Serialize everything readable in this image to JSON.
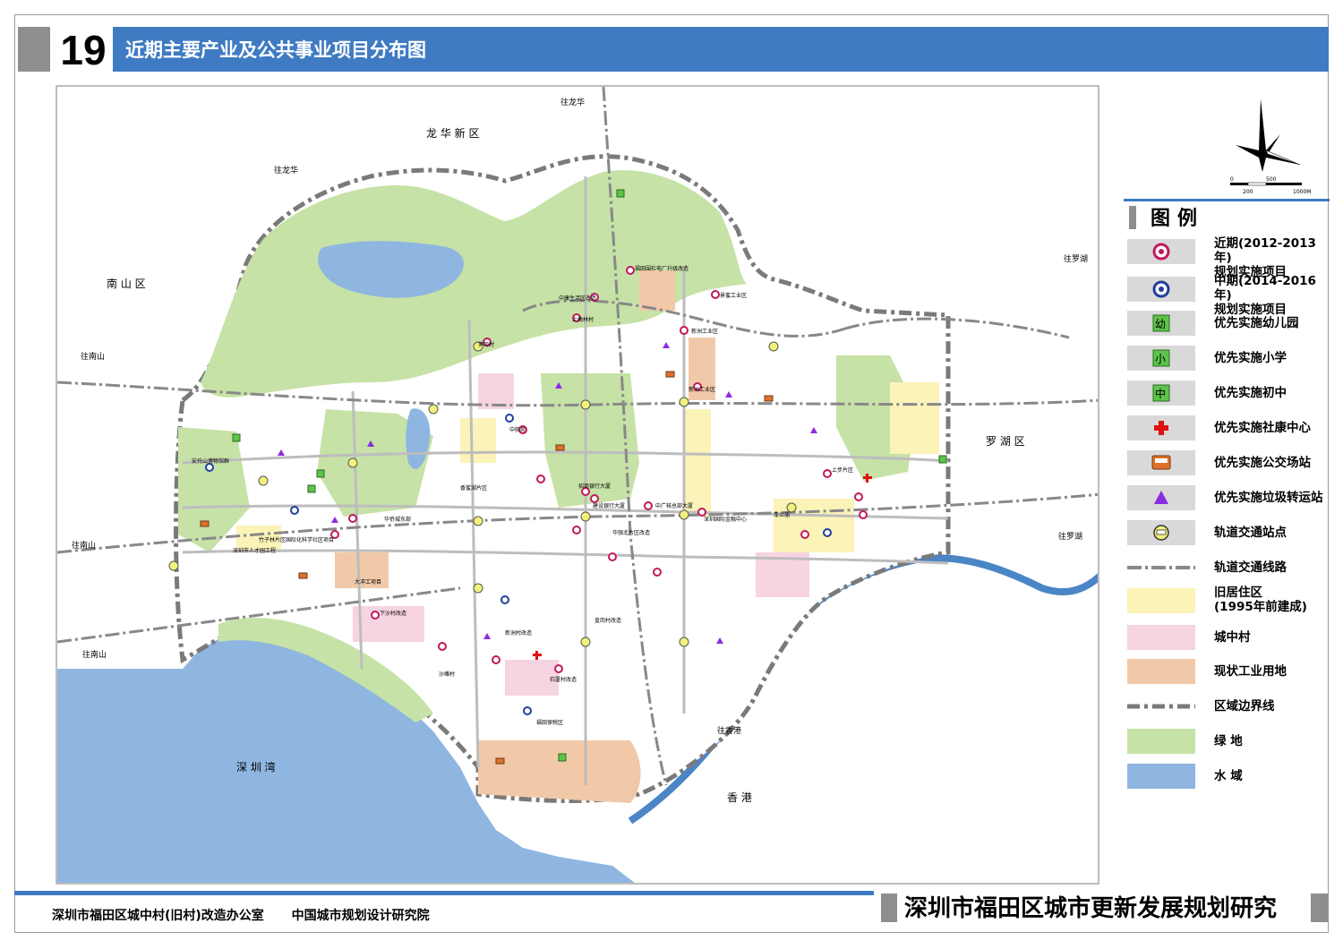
{
  "header": {
    "number": "19",
    "title": "近期主要产业及公共事业项目分布图"
  },
  "map": {
    "area_labels": [
      {
        "id": "longhua",
        "text": "龙 华 新 区"
      },
      {
        "id": "nanshan",
        "text": "南 山 区"
      },
      {
        "id": "luohu",
        "text": "罗 湖 区"
      },
      {
        "id": "shenzhenwan",
        "text": "深 圳 湾"
      },
      {
        "id": "hongkong",
        "text": "香 港"
      }
    ],
    "direction_labels": [
      {
        "id": "to-longhua-1",
        "text": "往龙华"
      },
      {
        "id": "to-longhua-2",
        "text": "往龙华"
      },
      {
        "id": "to-nanshan-1",
        "text": "往南山"
      },
      {
        "id": "to-nanshan-2",
        "text": "往南山"
      },
      {
        "id": "to-nanshan-3",
        "text": "往南山"
      },
      {
        "id": "to-luohu-1",
        "text": "往罗湖"
      },
      {
        "id": "to-luohu-2",
        "text": "往罗湖"
      },
      {
        "id": "to-hongkong",
        "text": "往香港"
      }
    ],
    "project_labels": [
      {
        "id": "p1",
        "text": "福田围栏电厂升级改造"
      },
      {
        "id": "p2",
        "text": "中康生活区改造"
      },
      {
        "id": "p3",
        "text": "上梅林村"
      },
      {
        "id": "p4",
        "text": "新洲工业区"
      },
      {
        "id": "p5",
        "text": "笋岗村"
      },
      {
        "id": "p6",
        "text": "景蜜工业区"
      },
      {
        "id": "p7",
        "text": "新洲工业区"
      },
      {
        "id": "p8",
        "text": "中航苑"
      },
      {
        "id": "p9",
        "text": "招商银行大厦"
      },
      {
        "id": "p10",
        "text": "建设银行大厦"
      },
      {
        "id": "p11",
        "text": "中广核总部大厦"
      },
      {
        "id": "p12",
        "text": "深圳国际金融中心"
      },
      {
        "id": "p13",
        "text": "上步片区"
      },
      {
        "id": "p14",
        "text": "华侨城东部"
      },
      {
        "id": "p15",
        "text": "香蜜湖片区"
      },
      {
        "id": "p16",
        "text": "车公庙"
      },
      {
        "id": "p17",
        "text": "福田保税区"
      },
      {
        "id": "p18",
        "text": "下沙村改造"
      },
      {
        "id": "p19",
        "text": "沙嘴村"
      },
      {
        "id": "p20",
        "text": "石厦村改造"
      },
      {
        "id": "p21",
        "text": "新洲村改造"
      },
      {
        "id": "p22",
        "text": "皇岗村改造"
      },
      {
        "id": "p23",
        "text": "深圳市人才园工程"
      },
      {
        "id": "p24",
        "text": "竹子林片区国际化科学社区项目"
      },
      {
        "id": "p25",
        "text": "安托山博物馆群"
      },
      {
        "id": "p26",
        "text": "大冲工项目"
      },
      {
        "id": "p27",
        "text": "华强北片区改造"
      }
    ]
  },
  "compass": {
    "scale_ticks": [
      "0",
      "500",
      "200",
      "1000M"
    ]
  },
  "legend": {
    "title": "图例",
    "items": [
      {
        "id": "near-term",
        "label": "近期(2012-2013年)\n规划实施项目",
        "icon": "magenta-circle-icon"
      },
      {
        "id": "mid-term",
        "label": "中期(2014-2016年)\n规划实施项目",
        "icon": "blue-circle-icon"
      },
      {
        "id": "kindergarten",
        "label": "优先实施幼儿园",
        "icon": "kindergarten-icon",
        "glyph": "幼"
      },
      {
        "id": "primary",
        "label": "优先实施小学",
        "icon": "primary-school-icon",
        "glyph": "小"
      },
      {
        "id": "middle",
        "label": "优先实施初中",
        "icon": "middle-school-icon",
        "glyph": "中"
      },
      {
        "id": "health",
        "label": "优先实施社康中心",
        "icon": "red-cross-icon"
      },
      {
        "id": "bus",
        "label": "优先实施公交场站",
        "icon": "bus-icon"
      },
      {
        "id": "garbage",
        "label": "优先实施垃圾转运站",
        "icon": "purple-triangle-icon"
      },
      {
        "id": "rail-station",
        "label": "轨道交通站点",
        "icon": "rail-station-icon"
      },
      {
        "id": "rail-line",
        "label": "轨道交通线路",
        "icon": "rail-line-icon"
      },
      {
        "id": "old-housing",
        "label": "旧居住区\n(1995年前建成)",
        "icon": "yellow-area-icon"
      },
      {
        "id": "urban-village",
        "label": "城中村",
        "icon": "pink-area-icon"
      },
      {
        "id": "industrial",
        "label": "现状工业用地",
        "icon": "orange-area-icon"
      },
      {
        "id": "boundary",
        "label": "区域边界线",
        "icon": "boundary-line-icon"
      },
      {
        "id": "green",
        "label": "绿 地",
        "icon": "green-area-icon"
      },
      {
        "id": "water",
        "label": "水 域",
        "icon": "water-area-icon"
      }
    ]
  },
  "footer": {
    "org1": "深圳市福田区城中村(旧村)改造办公室",
    "org2": "中国城市规划设计研究院",
    "report_title": "深圳市福田区城市更新发展规划研究"
  },
  "colors": {
    "accent_blue": "#3e7bc2",
    "grey": "#8e8e8e",
    "green": "#c6e2a6",
    "water": "#8fb6e0",
    "old_housing": "#fbf3b8",
    "urban_village": "#f6d4e2",
    "industrial": "#f1c9a8",
    "magenta": "#c2185b",
    "blue_dot": "#1f3f9a",
    "purple": "#8b2be2",
    "red": "#e01010"
  }
}
